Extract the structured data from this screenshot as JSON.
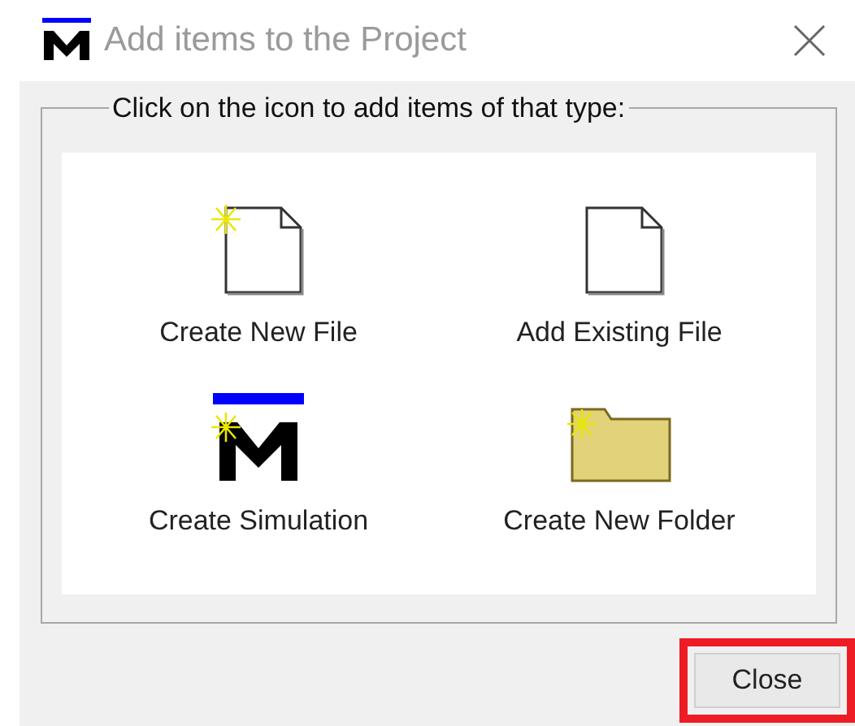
{
  "window": {
    "title": "Add items to the Project"
  },
  "group": {
    "legend": "Click on the icon to add items of that type:"
  },
  "items": [
    {
      "label": "Create New File",
      "kind": "new-file"
    },
    {
      "label": "Add Existing File",
      "kind": "file"
    },
    {
      "label": "Create Simulation",
      "kind": "simulation"
    },
    {
      "label": "Create New Folder",
      "kind": "new-folder"
    }
  ],
  "buttons": [
    {
      "label": "Close",
      "highlighted": true
    }
  ]
}
